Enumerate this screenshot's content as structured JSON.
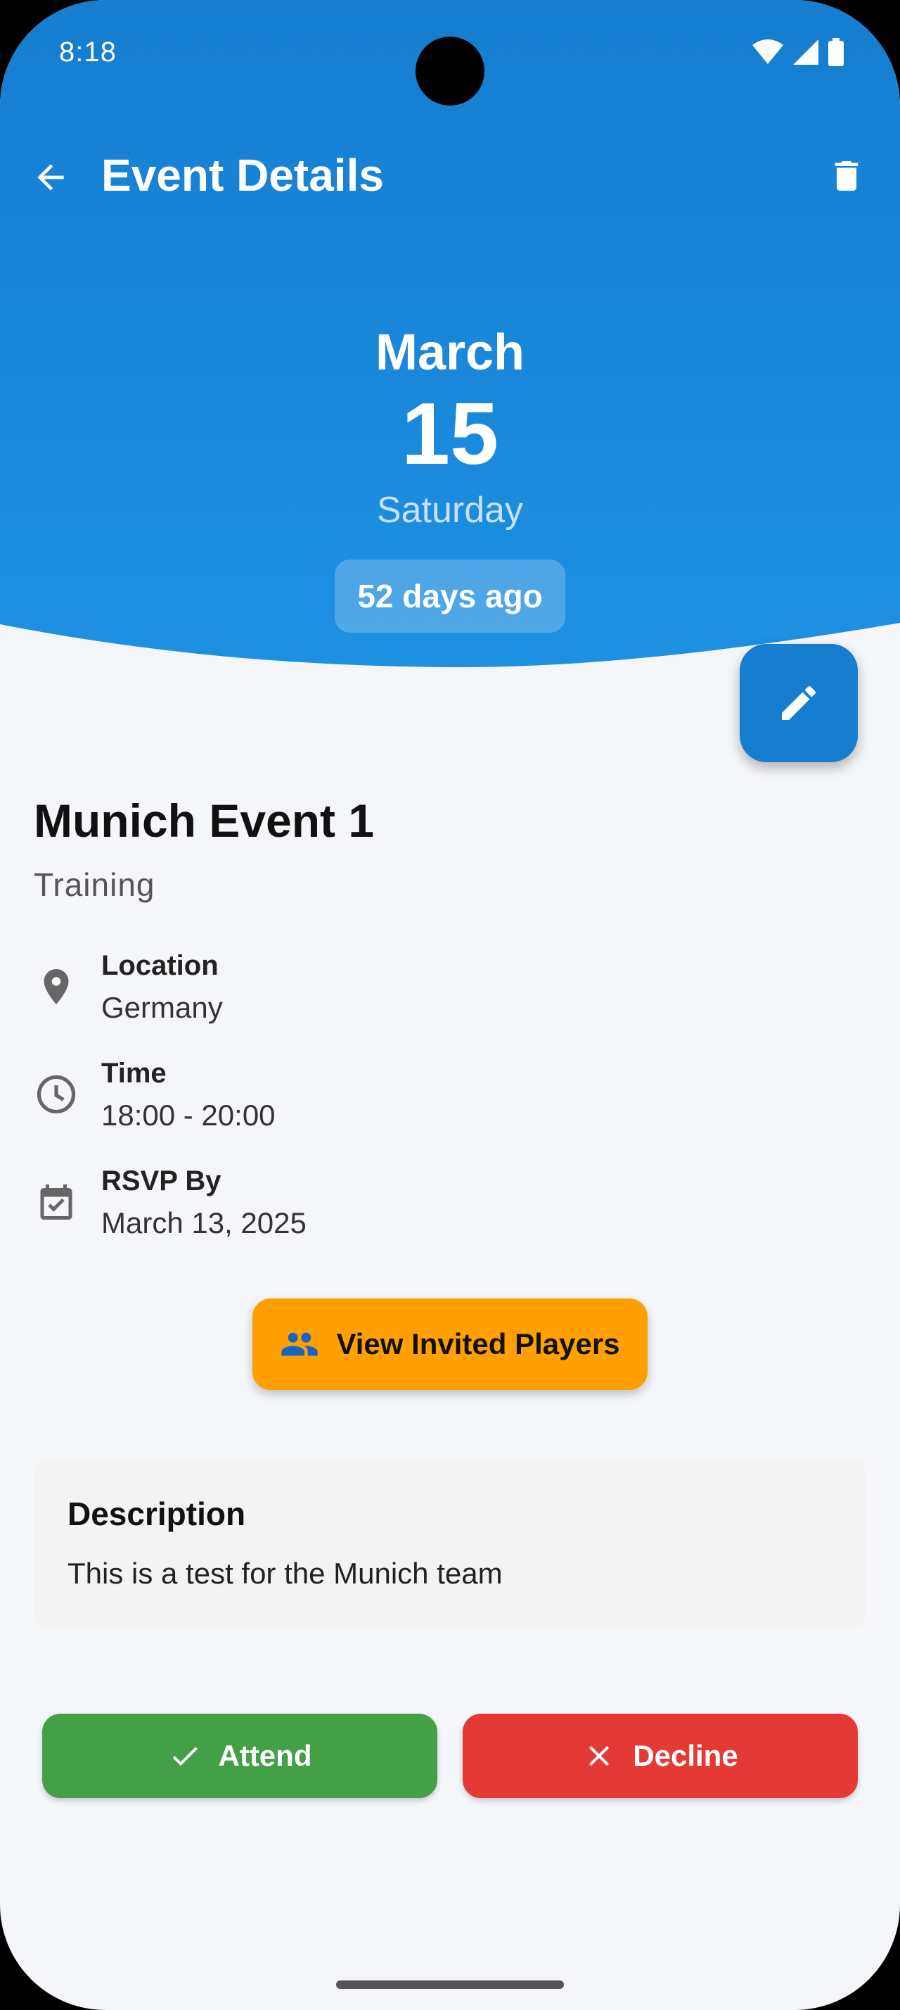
{
  "status_bar": {
    "time": "8:18"
  },
  "app_bar": {
    "title": "Event Details"
  },
  "date": {
    "month": "March",
    "day": "15",
    "weekday": "Saturday",
    "relative": "52 days ago"
  },
  "event": {
    "title": "Munich Event 1",
    "type": "Training"
  },
  "details": [
    {
      "label": "Location",
      "value": "Germany",
      "icon": "location-pin-icon"
    },
    {
      "label": "Time",
      "value": "18:00 - 20:00",
      "icon": "clock-icon"
    },
    {
      "label": "RSVP By",
      "value": "March 13, 2025",
      "icon": "calendar-check-icon"
    }
  ],
  "buttons": {
    "invited": "View Invited Players",
    "attend": "Attend",
    "decline": "Decline"
  },
  "description": {
    "title": "Description",
    "text": "This is a test for the Munich team"
  },
  "colors": {
    "header_top": "#167dcf",
    "header_bottom": "#1e90e2",
    "fab": "#167dcf",
    "invite": "#ffa000",
    "attend": "#43a047",
    "decline": "#e53935",
    "background": "#f4f6fa"
  }
}
